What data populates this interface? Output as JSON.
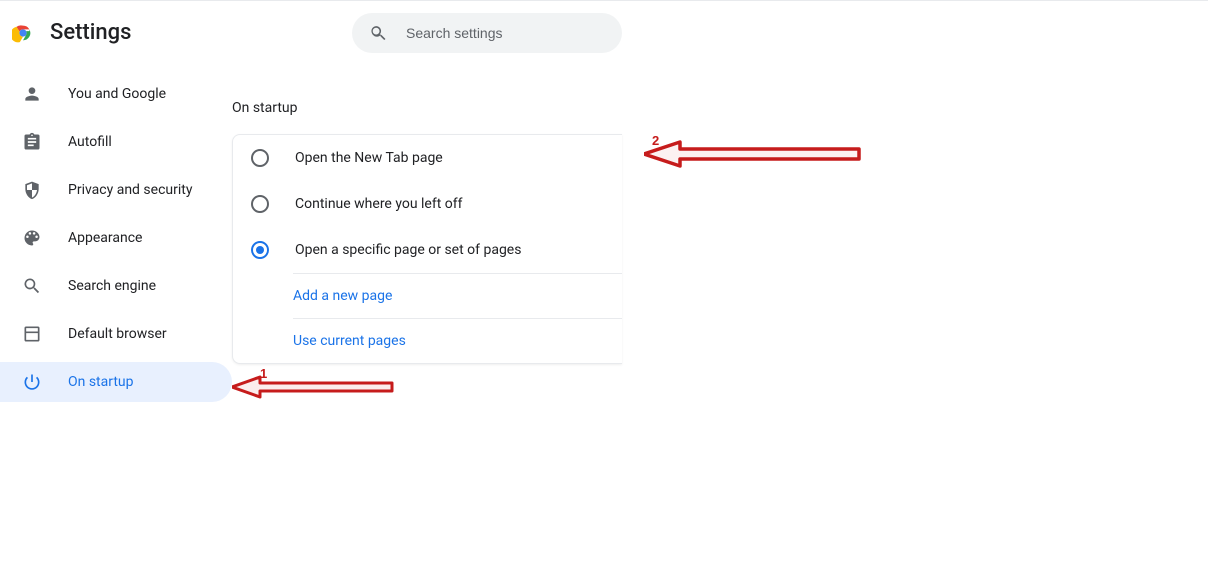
{
  "header": {
    "title": "Settings",
    "search_placeholder": "Search settings"
  },
  "sidebar": {
    "items": [
      {
        "icon": "person",
        "label": "You and Google",
        "selected": false
      },
      {
        "icon": "clipboard",
        "label": "Autofill",
        "selected": false
      },
      {
        "icon": "shield",
        "label": "Privacy and security",
        "selected": false
      },
      {
        "icon": "palette",
        "label": "Appearance",
        "selected": false
      },
      {
        "icon": "search",
        "label": "Search engine",
        "selected": false
      },
      {
        "icon": "browser",
        "label": "Default browser",
        "selected": false
      },
      {
        "icon": "power",
        "label": "On startup",
        "selected": true
      }
    ]
  },
  "main": {
    "section_title": "On startup",
    "options": [
      {
        "label": "Open the New Tab page",
        "checked": false
      },
      {
        "label": "Continue where you left off",
        "checked": false
      },
      {
        "label": "Open a specific page or set of pages",
        "checked": true
      }
    ],
    "actions": {
      "add_page": "Add a new page",
      "use_current": "Use current pages"
    }
  },
  "annotations": {
    "label1": "1",
    "label2": "2"
  }
}
